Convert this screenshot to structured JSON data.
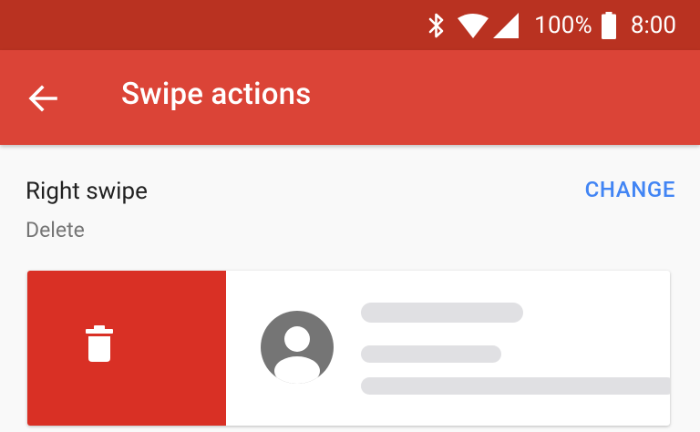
{
  "status_bar": {
    "icons": [
      "bluetooth-icon",
      "wifi-icon",
      "cellular-signal-icon",
      "battery-icon"
    ],
    "battery_percent": "100%",
    "time": "8:00"
  },
  "app_bar": {
    "back_icon": "arrow-back-icon",
    "title": "Swipe actions",
    "background_color": "#db4437"
  },
  "setting": {
    "title": "Right swipe",
    "value": "Delete",
    "change_label": "CHANGE",
    "accent_color": "#4285f4"
  },
  "preview": {
    "action_icon": "trash-icon",
    "action_color": "#d93025",
    "avatar_icon": "avatar-placeholder-icon"
  }
}
